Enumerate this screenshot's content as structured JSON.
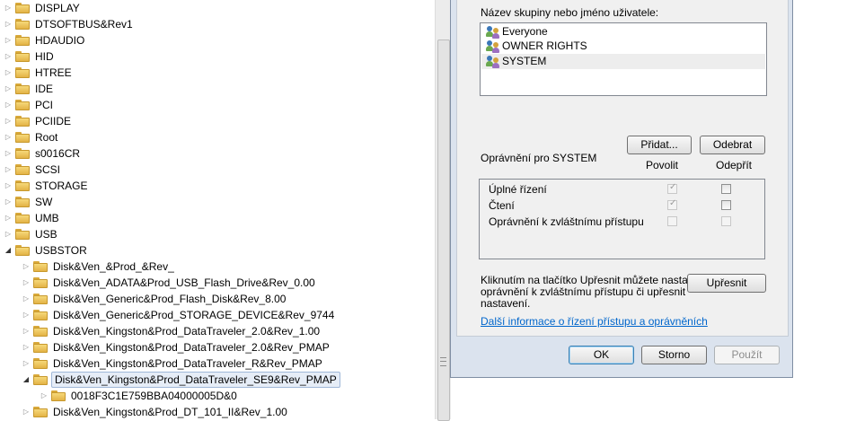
{
  "tree": {
    "items": [
      {
        "label": "DISPLAY",
        "level": 0,
        "expanded": false
      },
      {
        "label": "DTSOFTBUS&Rev1",
        "level": 0,
        "expanded": false
      },
      {
        "label": "HDAUDIO",
        "level": 0,
        "expanded": false
      },
      {
        "label": "HID",
        "level": 0,
        "expanded": false
      },
      {
        "label": "HTREE",
        "level": 0,
        "expanded": false
      },
      {
        "label": "IDE",
        "level": 0,
        "expanded": false
      },
      {
        "label": "PCI",
        "level": 0,
        "expanded": false
      },
      {
        "label": "PCIIDE",
        "level": 0,
        "expanded": false
      },
      {
        "label": "Root",
        "level": 0,
        "expanded": false
      },
      {
        "label": "s0016CR",
        "level": 0,
        "expanded": false
      },
      {
        "label": "SCSI",
        "level": 0,
        "expanded": false
      },
      {
        "label": "STORAGE",
        "level": 0,
        "expanded": false
      },
      {
        "label": "SW",
        "level": 0,
        "expanded": false
      },
      {
        "label": "UMB",
        "level": 0,
        "expanded": false
      },
      {
        "label": "USB",
        "level": 0,
        "expanded": false
      },
      {
        "label": "USBSTOR",
        "level": 0,
        "expanded": true
      },
      {
        "label": "Disk&Ven_&Prod_&Rev_",
        "level": 1,
        "expanded": false
      },
      {
        "label": "Disk&Ven_ADATA&Prod_USB_Flash_Drive&Rev_0.00",
        "level": 1,
        "expanded": false
      },
      {
        "label": "Disk&Ven_Generic&Prod_Flash_Disk&Rev_8.00",
        "level": 1,
        "expanded": false
      },
      {
        "label": "Disk&Ven_Generic&Prod_STORAGE_DEVICE&Rev_9744",
        "level": 1,
        "expanded": false
      },
      {
        "label": "Disk&Ven_Kingston&Prod_DataTraveler_2.0&Rev_1.00",
        "level": 1,
        "expanded": false
      },
      {
        "label": "Disk&Ven_Kingston&Prod_DataTraveler_2.0&Rev_PMAP",
        "level": 1,
        "expanded": false
      },
      {
        "label": "Disk&Ven_Kingston&Prod_DataTraveler_R&Rev_PMAP",
        "level": 1,
        "expanded": false
      },
      {
        "label": "Disk&Ven_Kingston&Prod_DataTraveler_SE9&Rev_PMAP",
        "level": 1,
        "expanded": true,
        "selected": true
      },
      {
        "label": "0018F3C1E759BBA04000005D&0",
        "level": 2,
        "expanded": false
      },
      {
        "label": "Disk&Ven_Kingston&Prod_DT_101_II&Rev_1.00",
        "level": 1,
        "expanded": false
      }
    ]
  },
  "dialog": {
    "groups_label": "Název skupiny nebo jméno uživatele:",
    "groups": [
      {
        "name": "Everyone",
        "selected": false
      },
      {
        "name": "OWNER RIGHTS",
        "selected": false
      },
      {
        "name": "SYSTEM",
        "selected": true
      }
    ],
    "add_button": "Přidat...",
    "remove_button": "Odebrat",
    "permissions_for": "Oprávnění pro SYSTEM",
    "allow_header": "Povolit",
    "deny_header": "Odepřít",
    "permissions": [
      {
        "name": "Úplné řízení",
        "allow": true,
        "deny": false,
        "disabled": false
      },
      {
        "name": "Čtení",
        "allow": true,
        "deny": false,
        "disabled": false
      },
      {
        "name": "Oprávnění k zvláštnímu přístupu",
        "allow": false,
        "deny": false,
        "disabled": true
      }
    ],
    "advanced_note_lines": [
      "Kliknutím na tlačítko Upřesnit můžete nastavit",
      "oprávnění k zvláštnímu přístupu či upřesnit",
      "nastavení."
    ],
    "advanced_button": "Upřesnit",
    "more_info_link": "Další informace o řízení přístupu a oprávněních",
    "ok_button": "OK",
    "cancel_button": "Storno",
    "apply_button": "Použít"
  }
}
